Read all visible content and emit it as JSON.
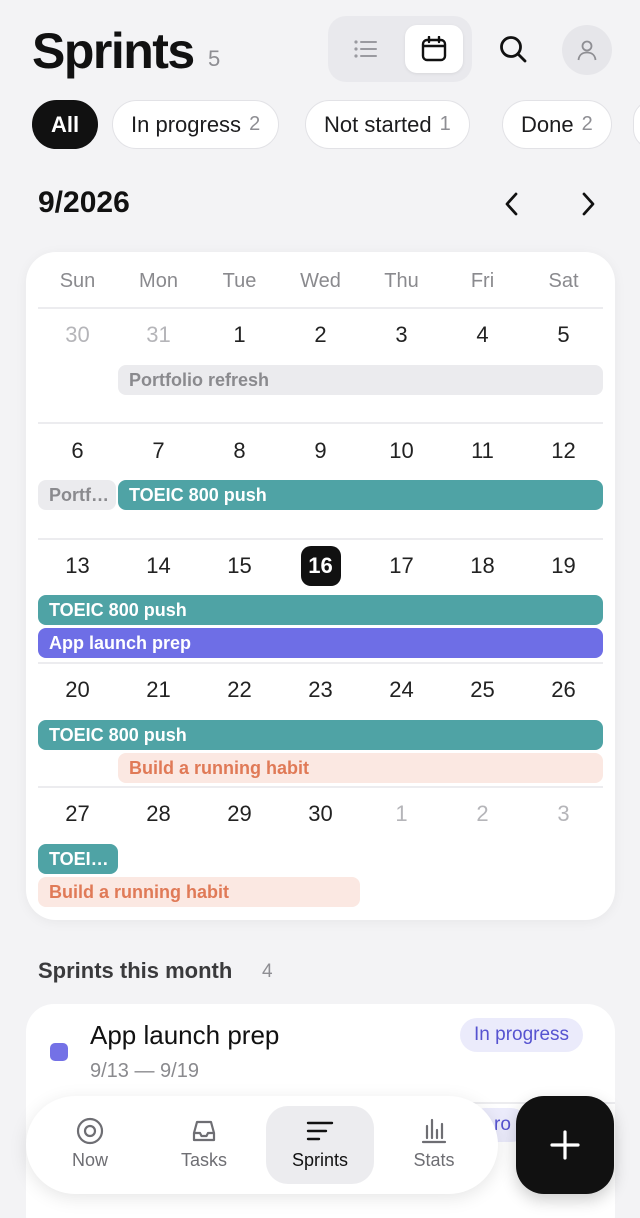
{
  "header": {
    "title": "Sprints",
    "count": "5"
  },
  "filters": [
    {
      "label": "All",
      "count": "",
      "active": true
    },
    {
      "label": "In progress",
      "count": "2"
    },
    {
      "label": "Not started",
      "count": "1"
    },
    {
      "label": "Done",
      "count": "2"
    }
  ],
  "calendar": {
    "month_label": "9/2026",
    "weekdays": [
      "Sun",
      "Mon",
      "Tue",
      "Wed",
      "Thu",
      "Fri",
      "Sat"
    ],
    "weeks": [
      [
        "30",
        "31",
        "1",
        "2",
        "3",
        "4",
        "5"
      ],
      [
        "6",
        "7",
        "8",
        "9",
        "10",
        "11",
        "12"
      ],
      [
        "13",
        "14",
        "15",
        "16",
        "17",
        "18",
        "19"
      ],
      [
        "20",
        "21",
        "22",
        "23",
        "24",
        "25",
        "26"
      ],
      [
        "27",
        "28",
        "29",
        "30",
        "1",
        "2",
        "3"
      ]
    ],
    "today": "16",
    "events": {
      "w1_portfolio": "Portfolio refresh",
      "w2_portfolio": "Portf…",
      "w2_toeic": "TOEIC 800 push",
      "w3_toeic": "TOEIC 800 push",
      "w3_app": "App launch prep",
      "w4_toeic": "TOEIC 800 push",
      "w4_running": "Build a running habit",
      "w5_toeic": "TOEI…",
      "w5_running": "Build a running habit"
    }
  },
  "sprints_section": {
    "title": "Sprints this month",
    "count": "4"
  },
  "sprint_list": [
    {
      "name": "App launch prep",
      "dates": "9/13 — 9/19",
      "status": "In progress"
    }
  ],
  "peek_badge_text": "ro",
  "tabbar": {
    "now": "Now",
    "tasks": "Tasks",
    "sprints": "Sprints",
    "stats": "Stats"
  },
  "colors": {
    "teal": "#4fa3a5",
    "purple": "#6e6ee6",
    "peach_bg": "#fbe8e2",
    "peach_text": "#e07a57",
    "gray_bar": "#ebebee"
  }
}
